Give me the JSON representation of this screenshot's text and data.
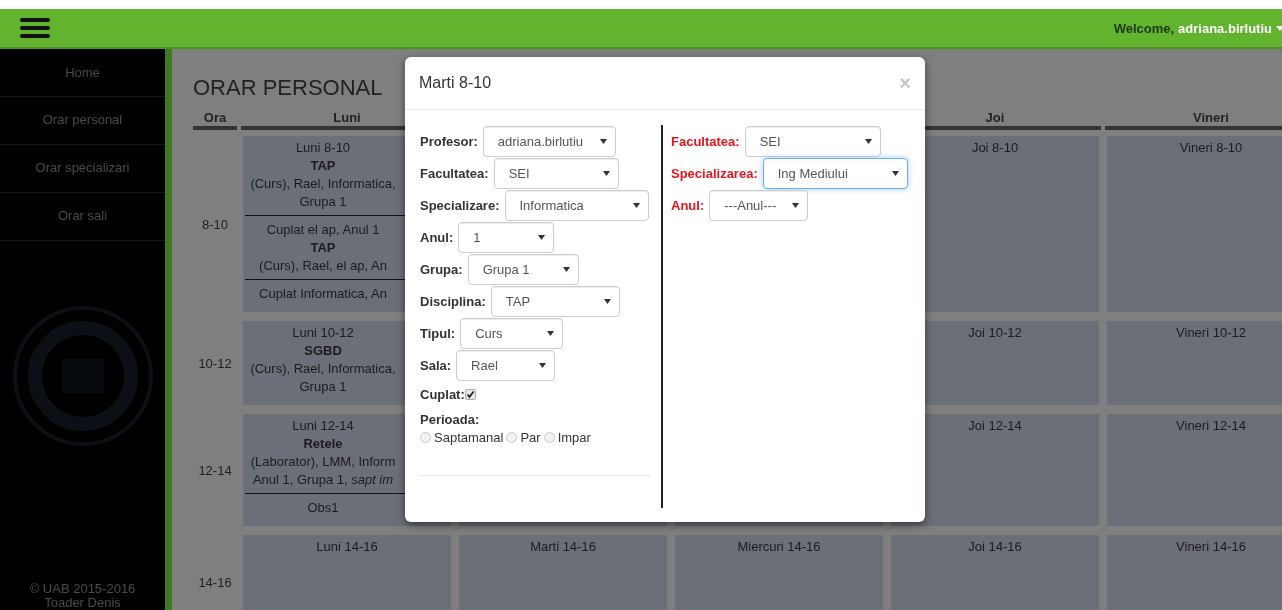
{
  "navbar": {
    "welcome": "Welcome,",
    "user": "adriana.birlutiu"
  },
  "sidebar": {
    "items": [
      {
        "label": "Home"
      },
      {
        "label": "Orar personal"
      },
      {
        "label": "Orar specializari"
      },
      {
        "label": "Orar sali"
      }
    ],
    "footer": [
      "© UAB 2015-2016",
      "Toader Denis"
    ]
  },
  "page_title": "ORAR PERSONAL",
  "table": {
    "columns": [
      "Ora",
      "Luni",
      "",
      "",
      "Joi",
      "Vineri"
    ],
    "rows": [
      {
        "cells": [
          {
            "text": "8-10"
          },
          {
            "entries": [
              {
                "lines": [
                  {
                    "text": "Luni 8-10",
                    "bold": false
                  },
                  {
                    "text": "TAP",
                    "bold": true
                  },
                  {
                    "text": "(Curs), Rael, Informatica,",
                    "bold": false
                  },
                  {
                    "text": "Grupa 1",
                    "bold": false
                  }
                ]
              },
              {
                "lines": [
                  {
                    "text": "Cuplat el ap, Anul 1",
                    "bold": false
                  },
                  {
                    "text": "TAP",
                    "bold": true
                  },
                  {
                    "text": "(Curs), Rael, el ap, An",
                    "bold": false
                  }
                ]
              },
              {
                "lines": [
                  {
                    "text": "Cuplat Informatica, An",
                    "bold": false
                  }
                ]
              }
            ]
          },
          {},
          {},
          {
            "entries": [
              {
                "lines": [
                  {
                    "text": "Joi 8-10",
                    "bold": false
                  }
                ]
              }
            ]
          },
          {
            "entries": [
              {
                "lines": [
                  {
                    "text": "Vineri 8-10",
                    "bold": false
                  }
                ]
              }
            ]
          }
        ]
      },
      {
        "cells": [
          {
            "text": "10-12"
          },
          {
            "entries": [
              {
                "lines": [
                  {
                    "text": "Luni 10-12",
                    "bold": false
                  },
                  {
                    "text": "SGBD",
                    "bold": true
                  },
                  {
                    "text": "(Curs), Rael, Informatica,",
                    "bold": false
                  },
                  {
                    "text": "Grupa 1",
                    "bold": false
                  }
                ]
              }
            ]
          },
          {},
          {},
          {
            "entries": [
              {
                "lines": [
                  {
                    "text": "Joi 10-12",
                    "bold": false
                  }
                ]
              }
            ]
          },
          {
            "entries": [
              {
                "lines": [
                  {
                    "text": "Vineri 10-12",
                    "bold": false
                  }
                ]
              }
            ]
          }
        ]
      },
      {
        "cells": [
          {
            "text": "12-14"
          },
          {
            "entries": [
              {
                "lines": [
                  {
                    "text": "Luni 12-14",
                    "bold": false
                  },
                  {
                    "text": "Retele",
                    "bold": true
                  },
                  {
                    "text": "(Laborator), LMM, Inform",
                    "bold": false
                  },
                  {
                    "text": "Anul 1, Grupa 1, *sapt im*",
                    "bold": false
                  }
                ]
              },
              {
                "lines": [
                  {
                    "text": "Obs1",
                    "bold": false
                  }
                ]
              }
            ]
          },
          {},
          {},
          {
            "entries": [
              {
                "lines": [
                  {
                    "text": "Joi 12-14",
                    "bold": false
                  }
                ]
              }
            ]
          },
          {
            "entries": [
              {
                "lines": [
                  {
                    "text": "Vineri 12-14",
                    "bold": false
                  }
                ]
              }
            ]
          }
        ]
      },
      {
        "cells": [
          {
            "text": "14-16"
          },
          {
            "entries": [
              {
                "lines": [
                  {
                    "text": "Luni 14-16",
                    "bold": false
                  }
                ]
              }
            ]
          },
          {
            "entries": [
              {
                "lines": [
                  {
                    "text": "Marti 14-16",
                    "bold": false
                  }
                ]
              }
            ]
          },
          {
            "entries": [
              {
                "lines": [
                  {
                    "text": "Miercuri 14-16",
                    "bold": false
                  }
                ]
              }
            ]
          },
          {
            "entries": [
              {
                "lines": [
                  {
                    "text": "Joi 14-16",
                    "bold": false
                  }
                ]
              }
            ]
          },
          {
            "entries": [
              {
                "lines": [
                  {
                    "text": "Vineri 14-16",
                    "bold": false
                  }
                ]
              }
            ]
          }
        ]
      }
    ]
  },
  "modal": {
    "title": "Marti 8-10",
    "close": "×",
    "left_fields": [
      {
        "label": "Profesor:",
        "value": "adriana.birlutiu",
        "required": false,
        "focused": false
      },
      {
        "label": "Facultatea:",
        "value": "SEI",
        "required": false,
        "focused": false
      },
      {
        "label": "Specializare:",
        "value": "Informatica",
        "required": false,
        "focused": false
      },
      {
        "label": "Anul:",
        "value": "1",
        "required": false,
        "focused": false
      },
      {
        "label": "Grupa:",
        "value": "Grupa 1",
        "required": false,
        "focused": false
      },
      {
        "label": "Disciplina:",
        "value": "TAP",
        "required": false,
        "focused": false
      },
      {
        "label": "Tipul:",
        "value": "Curs",
        "required": false,
        "focused": false
      },
      {
        "label": "Sala:",
        "value": "Rael",
        "required": false,
        "focused": false
      }
    ],
    "cuplat": {
      "label": "Cuplat:",
      "checked": true
    },
    "perioada": {
      "label": "Perioada:",
      "options": [
        {
          "label": "Saptamanal",
          "selected": false
        },
        {
          "label": "Par",
          "selected": false
        },
        {
          "label": "Impar",
          "selected": false
        }
      ]
    },
    "right_fields": [
      {
        "label": "Facultatea:",
        "value": "SEI",
        "required": true,
        "focused": false
      },
      {
        "label": "Specializarea:",
        "value": "Ing Mediului",
        "required": true,
        "focused": true
      },
      {
        "label": "Anul:",
        "value": "---Anul---",
        "required": true,
        "focused": false
      }
    ]
  }
}
